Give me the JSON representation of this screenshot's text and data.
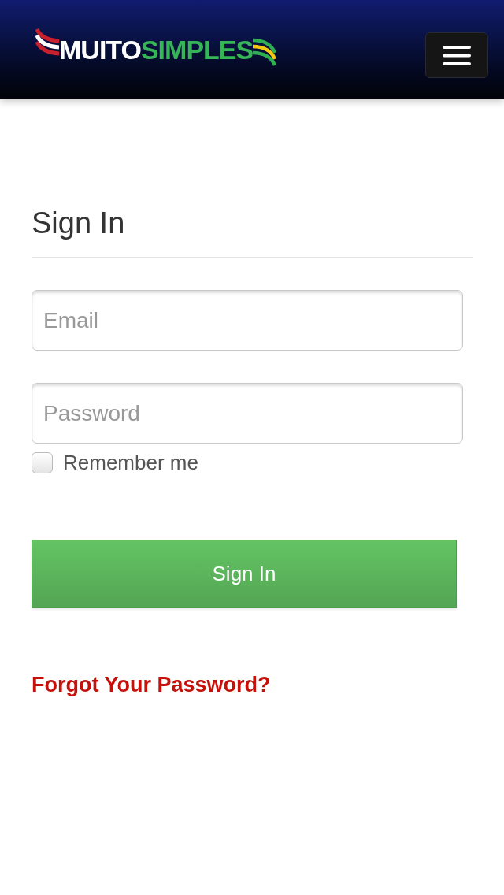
{
  "header": {
    "logo": {
      "first": "MUITO",
      "second": "SIMPLES"
    }
  },
  "form": {
    "title": "Sign In",
    "fields": [
      {
        "placeholder": "Email"
      },
      {
        "placeholder": "Password"
      }
    ],
    "remember": {
      "label": "Remember me",
      "checked": false
    },
    "submit": "Sign In",
    "forgot_link": "Forgot Your Password?"
  }
}
